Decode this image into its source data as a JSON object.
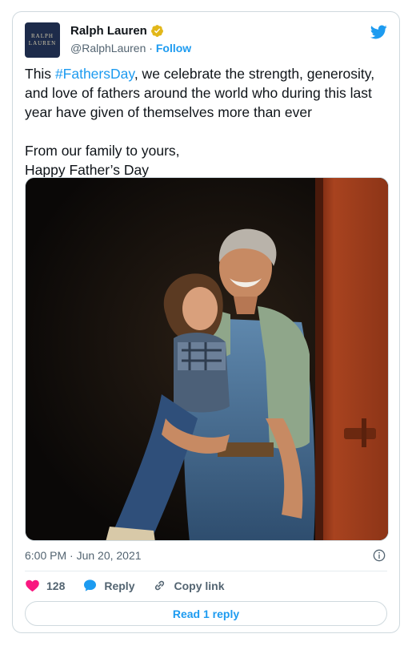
{
  "author": {
    "name": "Ralph Lauren",
    "handle": "@RalphLauren",
    "separator": "·",
    "follow_label": "Follow",
    "avatar_line1": "RALPH",
    "avatar_line2": "LAUREN"
  },
  "tweet": {
    "text_before": "This ",
    "hashtag": "#FathersDay",
    "text_after": ", we celebrate the strength, generosity, and love of fathers around the world who during this last year have given of themselves more than ever",
    "line2": "From our family to yours,",
    "line3": "Happy Father’s Day"
  },
  "timestamp": "6:00 PM · Jun 20, 2021",
  "actions": {
    "likes": "128",
    "reply_label": "Reply",
    "copy_link_label": "Copy link"
  },
  "read_replies_label": "Read 1 reply",
  "colors": {
    "accent": "#1d9bf0",
    "like": "#f91880",
    "verified": "#e2b719"
  },
  "icons": [
    "twitter-bird-icon",
    "verified-badge-icon",
    "info-icon",
    "heart-icon",
    "reply-bubble-icon",
    "link-icon"
  ]
}
